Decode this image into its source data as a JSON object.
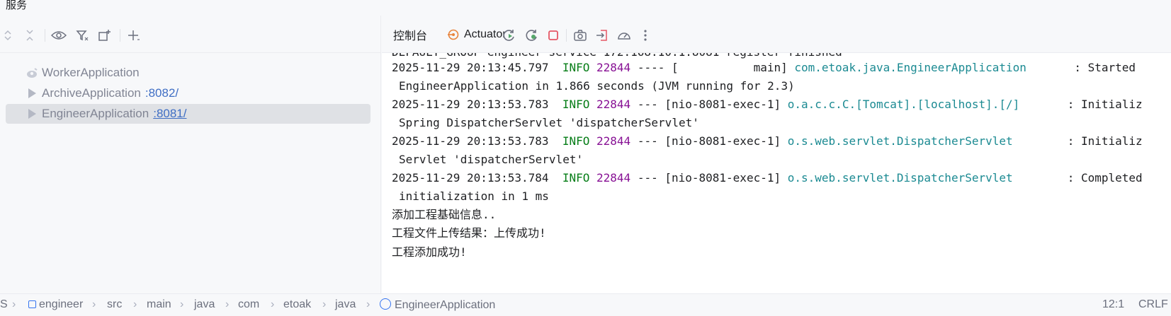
{
  "window": {
    "title": "服务"
  },
  "left_toolbar": {
    "icons": [
      "expand-all-icon",
      "collapse-all-icon",
      "eye-icon",
      "filter-icon",
      "new-tab-icon",
      "add-icon"
    ]
  },
  "tree": {
    "items": [
      {
        "name": "WorkerApplication",
        "port": "",
        "icon": "spring-boot-icon",
        "selected": false
      },
      {
        "name": "ArchiveApplication",
        "port": ":8082/",
        "icon": "run-icon",
        "selected": false
      },
      {
        "name": "EngineerApplication",
        "port": ":8081/",
        "icon": "run-icon",
        "selected": true
      }
    ]
  },
  "right_toolbar": {
    "tabs": [
      {
        "label": "控制台",
        "active": true
      },
      {
        "label": "Actuator",
        "active": false
      }
    ],
    "icons": [
      "rerun-icon",
      "rerun-debug-icon",
      "stop-icon",
      "screenshot-icon",
      "exit-icon",
      "gauge-icon",
      "more-icon"
    ]
  },
  "console": {
    "partial_top": "DEFAULT_GROUP engineer-service 172.168.10.1:8081 register finished",
    "lines": [
      {
        "ts": "2025-11-29 20:13:45.797",
        "level": "INFO",
        "pid": "22844",
        "thread": "---- [           main]",
        "logger": "com.etoak.java.EngineerApplication",
        "msg": ": Started",
        "cont": "EngineerApplication in 1.866 seconds (JVM running for 2.3)"
      },
      {
        "ts": "2025-11-29 20:13:53.783",
        "level": "INFO",
        "pid": "22844",
        "thread": "--- [nio-8081-exec-1]",
        "logger": "o.a.c.c.C.[Tomcat].[localhost].[/]",
        "msg": ": Initializ",
        "cont": "Spring DispatcherServlet 'dispatcherServlet'"
      },
      {
        "ts": "2025-11-29 20:13:53.783",
        "level": "INFO",
        "pid": "22844",
        "thread": "--- [nio-8081-exec-1]",
        "logger": "o.s.web.servlet.DispatcherServlet",
        "msg": ": Initializ",
        "cont": "Servlet 'dispatcherServlet'"
      },
      {
        "ts": "2025-11-29 20:13:53.784",
        "level": "INFO",
        "pid": "22844",
        "thread": "--- [nio-8081-exec-1]",
        "logger": "o.s.web.servlet.DispatcherServlet",
        "msg": ": Completed",
        "cont": "initialization in 1 ms"
      }
    ],
    "plain": [
      "添加工程基础信息..",
      "工程文件上传结果：上传成功!",
      "工程添加成功!"
    ]
  },
  "statusbar": {
    "breadcrumbs": [
      "S",
      "engineer",
      "src",
      "main",
      "java",
      "com",
      "etoak",
      "java",
      "EngineerApplication"
    ],
    "position": "12:1",
    "line_ending": "CRLF"
  }
}
